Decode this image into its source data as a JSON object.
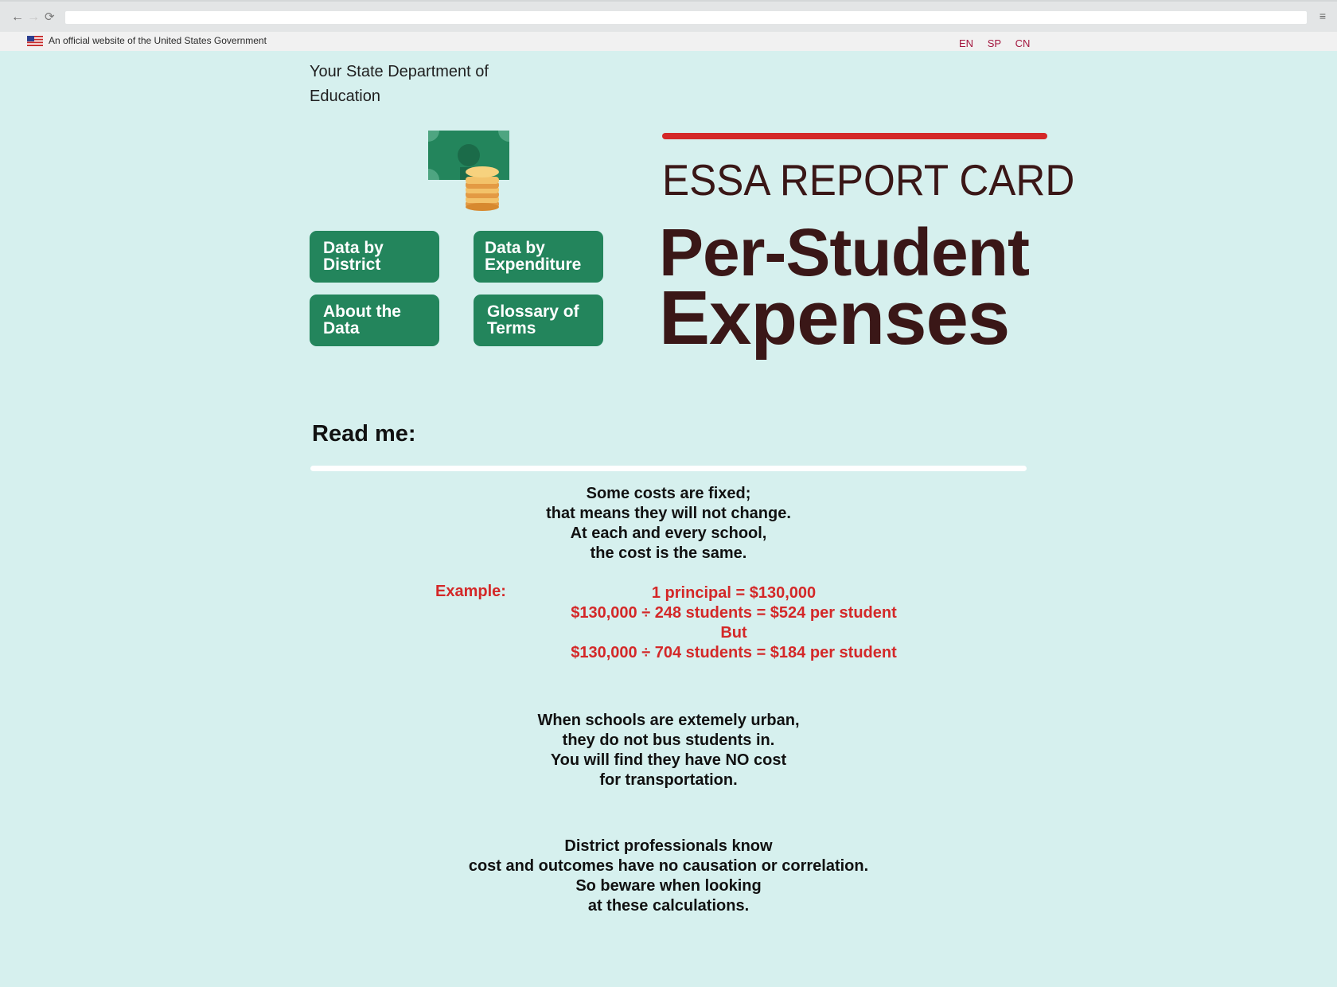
{
  "browser": {
    "back_icon": "←",
    "forward_icon": "→",
    "reload_icon": "⟳",
    "menu_icon": "≡",
    "address": ""
  },
  "gov_banner": {
    "text": "An official website of the United States Government",
    "languages": [
      "EN",
      "SP",
      "CN"
    ]
  },
  "header": {
    "department": "Your State Department of Education",
    "report_label": "ESSA REPORT CARD",
    "title_line1": "Per-Student",
    "title_line2": "Expenses",
    "accent_color": "#d42828",
    "title_color": "#3a1717"
  },
  "nav": {
    "buttons": [
      {
        "label": "Data by District"
      },
      {
        "label": "Data by Expenditure"
      },
      {
        "label": "About the Data"
      },
      {
        "label": "Glossary of Terms"
      }
    ],
    "button_color": "#23855c"
  },
  "readme": {
    "heading": "Read me:",
    "fixed_costs": [
      "Some costs are fixed;",
      "that means they will not change.",
      "At each and every school,",
      "the cost is the same."
    ],
    "example_label": "Example:",
    "example_lines": [
      "1 principal = $130,000",
      "$130,000 ÷ 248 students = $524 per student",
      "But",
      "$130,000 ÷ 704 students = $184 per student"
    ],
    "urban": [
      "When schools are extemely urban,",
      "they do not bus students in.",
      "You will find they have NO cost",
      "for transportation."
    ],
    "caution": [
      "District professionals know",
      "cost and outcomes have no causation or correlation.",
      "So beware when looking",
      "at these calculations."
    ]
  }
}
